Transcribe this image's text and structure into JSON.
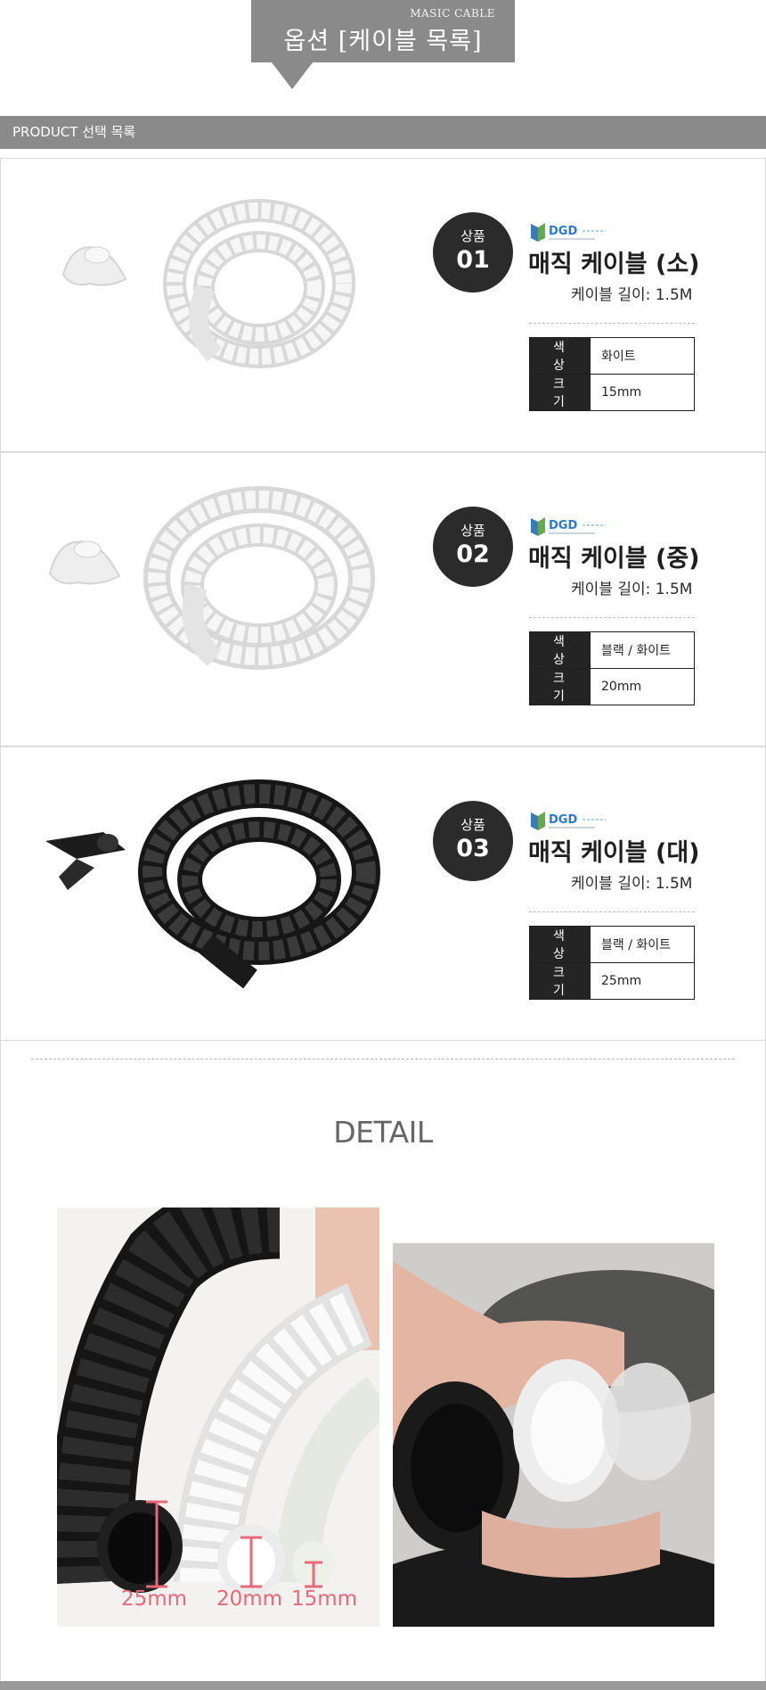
{
  "header": {
    "subtitle": "MASIC CABLE",
    "title": "옵션 [케이블 목록]"
  },
  "section_bar": {
    "label": "PRODUCT 선택 목록"
  },
  "products": [
    {
      "badge_label": "상품",
      "badge_number": "01",
      "name": "매직 케이블 (소)",
      "length": "케이블 길이: 1.5M",
      "specs": [
        {
          "key": "색 상",
          "value": "화이트"
        },
        {
          "key": "크 기",
          "value": "15mm"
        }
      ],
      "cable_color": "white"
    },
    {
      "badge_label": "상품",
      "badge_number": "02",
      "name": "매직 케이블 (중)",
      "length": "케이블 길이: 1.5M",
      "specs": [
        {
          "key": "색 상",
          "value": "블랙 / 화이트"
        },
        {
          "key": "크 기",
          "value": "20mm"
        }
      ],
      "cable_color": "white"
    },
    {
      "badge_label": "상품",
      "badge_number": "03",
      "name": "매직 케이블 (대)",
      "length": "케이블 길이: 1.5M",
      "specs": [
        {
          "key": "색 상",
          "value": "블랙 / 화이트"
        },
        {
          "key": "크 기",
          "value": "25mm"
        }
      ],
      "cable_color": "black"
    }
  ],
  "brand_logo": "DGD",
  "detail": {
    "title": "DETAIL",
    "measurements": [
      "25mm",
      "20mm",
      "15mm"
    ]
  },
  "colors": {
    "header_gray": "#8a8a8a",
    "badge": "#2b2b2b",
    "measure_pink": "#e8687a"
  }
}
